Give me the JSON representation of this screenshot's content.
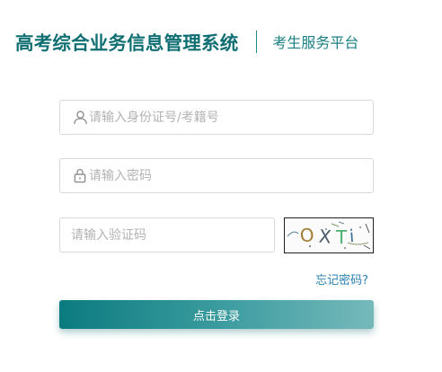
{
  "header": {
    "title": "高考综合业务信息管理系统",
    "subtitle": "考生服务平台"
  },
  "form": {
    "username": {
      "value": "",
      "placeholder": "请输入身份证号/考籍号",
      "icon": "user-icon"
    },
    "password": {
      "value": "",
      "placeholder": "请输入密码",
      "icon": "lock-icon"
    },
    "captcha_input": {
      "value": "",
      "placeholder": "请输入验证码"
    },
    "captcha_text": "OXTi",
    "forgot_label": "忘记密码?",
    "login_label": "点击登录"
  },
  "colors": {
    "brand": "#0e6e72",
    "link": "#2a7fb0",
    "button_start": "#0b7b80",
    "button_end": "#76b9bb"
  }
}
